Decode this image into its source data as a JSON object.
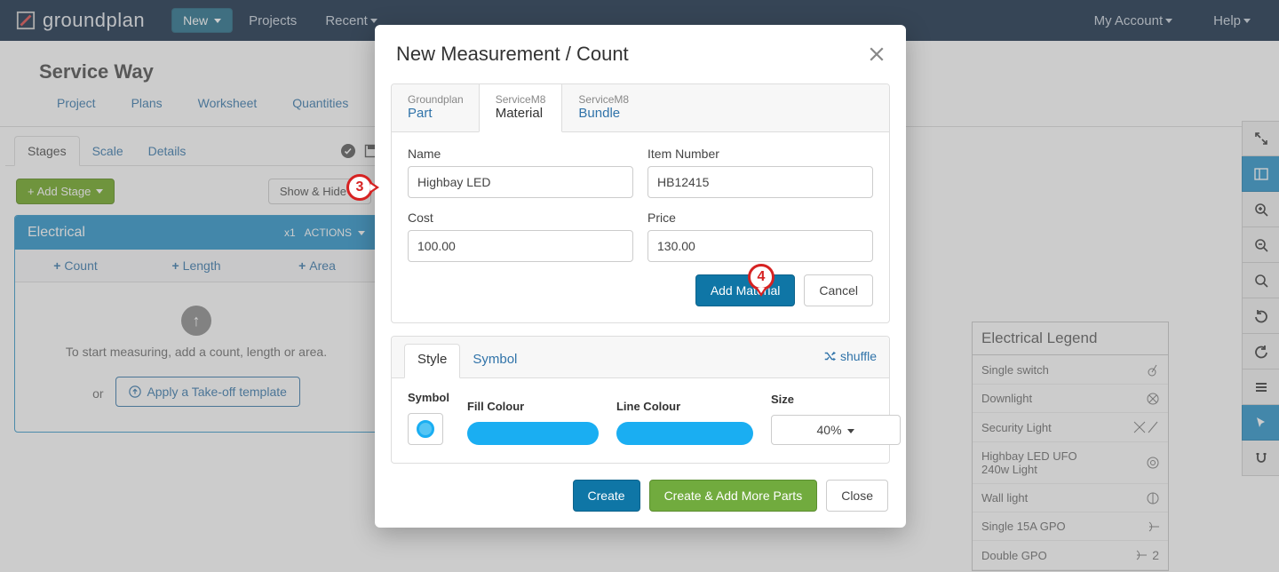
{
  "nav": {
    "brand": "groundplan",
    "new": "New",
    "projects": "Projects",
    "recent": "Recent",
    "account": "My Account",
    "help": "Help"
  },
  "page": {
    "title": "Service Way",
    "subtabs": [
      "Project",
      "Plans",
      "Worksheet",
      "Quantities"
    ],
    "secondary_tabs": {
      "stages": "Stages",
      "scale": "Scale",
      "details": "Details"
    },
    "add_stage": "Add Stage",
    "show_hide": "Show & Hide",
    "stage": {
      "name": "Electrical",
      "multiplier": "x1",
      "actions": "ACTIONS",
      "tabs": {
        "count": "Count",
        "length": "Length",
        "area": "Area"
      },
      "hint": "To start measuring, add a count, length or area.",
      "or": "or",
      "apply": "Apply a Take-off template"
    }
  },
  "legend": {
    "title": "Electrical Legend",
    "rows": [
      {
        "label": "Single switch",
        "count": ""
      },
      {
        "label": "Downlight",
        "count": ""
      },
      {
        "label": "Security Light",
        "count": ""
      },
      {
        "label": "Highbay LED UFO 240w Light",
        "count": ""
      },
      {
        "label": "Wall light",
        "count": ""
      },
      {
        "label": "Single 15A GPO",
        "count": ""
      },
      {
        "label": "Double GPO",
        "count": "2"
      }
    ]
  },
  "modal": {
    "title": "New Measurement / Count",
    "tabs": [
      {
        "sup": "Groundplan",
        "main": "Part"
      },
      {
        "sup": "ServiceM8",
        "main": "Material"
      },
      {
        "sup": "ServiceM8",
        "main": "Bundle"
      }
    ],
    "labels": {
      "name": "Name",
      "item_number": "Item Number",
      "cost": "Cost",
      "price": "Price"
    },
    "values": {
      "name": "Highbay LED",
      "item_number": "HB12415",
      "cost": "100.00",
      "price": "130.00"
    },
    "add_material": "Add Material",
    "cancel": "Cancel",
    "style": {
      "tabs": {
        "style": "Style",
        "symbol": "Symbol"
      },
      "shuffle": "shuffle",
      "labels": {
        "symbol": "Symbol",
        "fill": "Fill Colour",
        "line": "Line Colour",
        "size": "Size"
      },
      "size_value": "40%"
    },
    "footer": {
      "create": "Create",
      "create_more": "Create & Add More Parts",
      "close": "Close"
    }
  },
  "annotations": {
    "a3": "3",
    "a4": "4"
  }
}
